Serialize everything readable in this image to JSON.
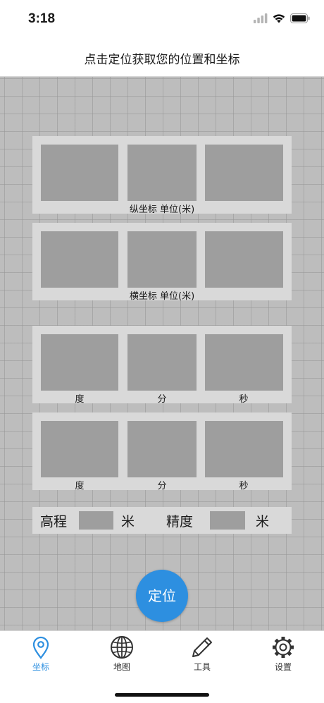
{
  "status_bar": {
    "time": "3:18"
  },
  "header": {
    "title": "点击定位获取您的位置和坐标"
  },
  "panels": {
    "northing": {
      "caption": "纵坐标  单位(米)"
    },
    "easting": {
      "caption": "横坐标  单位(米)"
    },
    "latitude_dms": {
      "deg": "度",
      "min": "分",
      "sec": "秒"
    },
    "longitude_dms": {
      "deg": "度",
      "min": "分",
      "sec": "秒"
    }
  },
  "elevation": {
    "label": "高程",
    "unit": "米",
    "accuracy_label": "精度",
    "accuracy_unit": "米"
  },
  "locate_button": {
    "label": "定位"
  },
  "tabs": [
    {
      "label": "坐标",
      "icon": "location-pin-icon",
      "active": true
    },
    {
      "label": "地图",
      "icon": "globe-icon",
      "active": false
    },
    {
      "label": "工具",
      "icon": "pencil-icon",
      "active": false
    },
    {
      "label": "设置",
      "icon": "gear-icon",
      "active": false
    }
  ],
  "colors": {
    "accent": "#2d8fe0",
    "grid_bg": "#bdbdbd",
    "panel": "#d9d9d9",
    "field": "#9e9e9e"
  }
}
